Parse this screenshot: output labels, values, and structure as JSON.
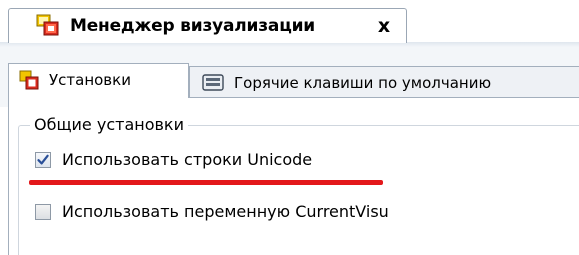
{
  "document_tab": {
    "title": "Менеджер визуализации",
    "close_glyph": "x",
    "icon": "visualization-manager-icon"
  },
  "sub_tabs": [
    {
      "label": "Установки",
      "icon": "settings-window-icon",
      "active": true
    },
    {
      "label": "Горячие клавиши по умолчанию",
      "icon": "keyboard-icon",
      "active": false
    }
  ],
  "general_settings": {
    "group_title": "Общие установки",
    "options": [
      {
        "label": "Использовать строки Unicode",
        "checked": true
      },
      {
        "label": "Использовать переменную CurrentVisu",
        "checked": false
      }
    ]
  },
  "colors": {
    "highlight_underline": "#e3181b",
    "check_mark": "#2a4f98",
    "tab_border": "#a3afbd"
  }
}
